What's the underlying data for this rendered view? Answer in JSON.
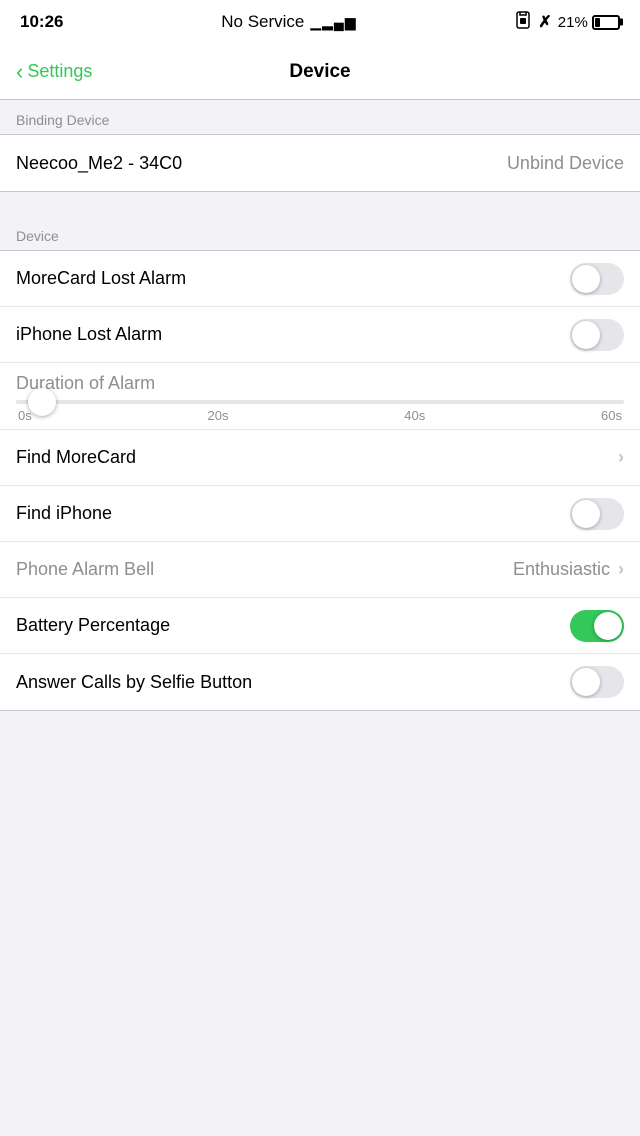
{
  "statusBar": {
    "time": "10:26",
    "network": "No Service",
    "signal": "▂▄▆",
    "bluetooth": "⌁",
    "battery": "21%"
  },
  "nav": {
    "back_label": "Settings",
    "title": "Device"
  },
  "sections": {
    "binding_device_header": "Binding Device",
    "device_header": "Device"
  },
  "rows": {
    "device_name": "Neecoo_Me2 - 34C0",
    "unbind_label": "Unbind Device",
    "morecard_lost_alarm_label": "MoreCard Lost Alarm",
    "iphone_lost_alarm_label": "iPhone Lost Alarm",
    "duration_label": "Duration of Alarm",
    "slider_ticks": [
      "0s",
      "20s",
      "40s",
      "60s"
    ],
    "find_morecard_label": "Find MoreCard",
    "find_iphone_label": "Find iPhone",
    "phone_alarm_bell_label": "Phone Alarm Bell",
    "phone_alarm_bell_value": "Enthusiastic",
    "battery_percentage_label": "Battery Percentage",
    "answer_calls_label": "Answer Calls by Selfie Button"
  },
  "toggles": {
    "morecard_lost_alarm": false,
    "iphone_lost_alarm": false,
    "find_iphone": false,
    "battery_percentage": true,
    "answer_calls": false
  }
}
